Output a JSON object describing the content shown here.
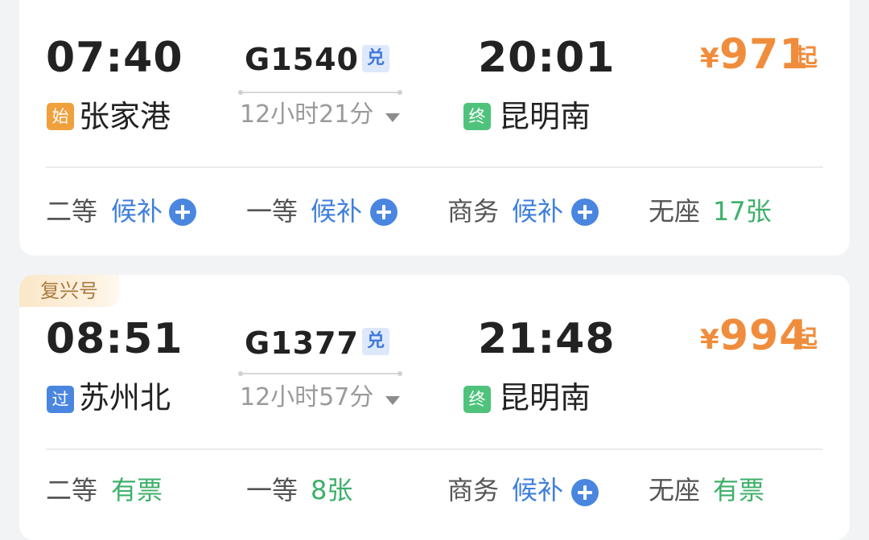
{
  "trains": [
    {
      "depart_time": "07:40",
      "depart_badge": "始",
      "depart_badge_color": "#f0a03c",
      "depart_station": "张家港",
      "train_number": "G1540",
      "exchange_mark": "兑",
      "duration": "12小时21分",
      "arrive_time": "20:01",
      "arrive_badge": "终",
      "arrive_badge_color": "#4fc27c",
      "arrive_station": "昆明南",
      "price_symbol": "¥",
      "price": "971",
      "price_suffix": "起",
      "seats": [
        {
          "class": "二等",
          "status": "候补",
          "waitlist": true
        },
        {
          "class": "一等",
          "status": "候补",
          "waitlist": true
        },
        {
          "class": "商务",
          "status": "候补",
          "waitlist": true
        },
        {
          "class": "无座",
          "status": "17张",
          "waitlist": false
        }
      ]
    },
    {
      "tag": "复兴号",
      "depart_time": "08:51",
      "depart_badge": "过",
      "depart_badge_color": "#4a86df",
      "depart_station": "苏州北",
      "train_number": "G1377",
      "exchange_mark": "兑",
      "duration": "12小时57分",
      "arrive_time": "21:48",
      "arrive_badge": "终",
      "arrive_badge_color": "#4fc27c",
      "arrive_station": "昆明南",
      "price_symbol": "¥",
      "price": "994",
      "price_suffix": "起",
      "seats": [
        {
          "class": "二等",
          "status": "有票",
          "waitlist": false
        },
        {
          "class": "一等",
          "status": "8张",
          "waitlist": false
        },
        {
          "class": "商务",
          "status": "候补",
          "waitlist": true
        },
        {
          "class": "无座",
          "status": "有票",
          "waitlist": false
        }
      ]
    }
  ]
}
